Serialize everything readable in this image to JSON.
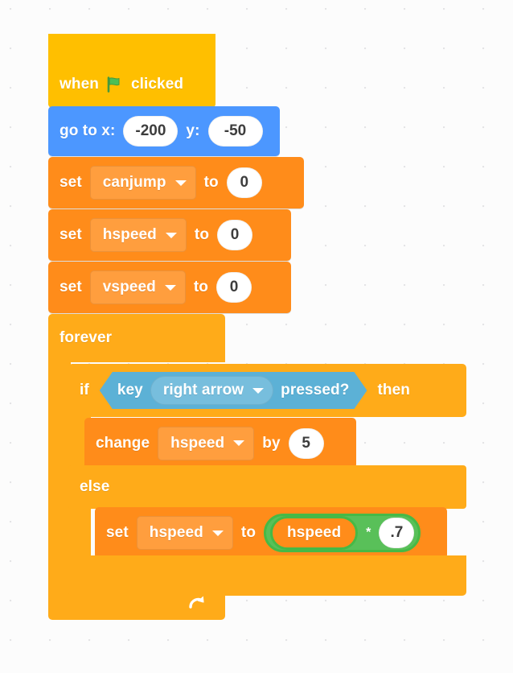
{
  "workspace": {
    "background_color": "#fcfcfc",
    "dot_grid": true
  },
  "palette": {
    "events_yellow": "#FFBF00",
    "motion_blue": "#4C97FF",
    "variables_orange": "#FF8C1A",
    "control_amber": "#FFAB19",
    "sensing_blue": "#5CB1D6",
    "operators_green": "#59C059",
    "operators_green_outline": "#46B946",
    "input_white": "#FFFFFF",
    "text_white": "#FFFFFF",
    "input_text_dark": "#3D3D3D"
  },
  "script": {
    "hat": {
      "word_when": "when",
      "flag_icon": "green-flag-icon",
      "word_clicked": "clicked"
    },
    "goto": {
      "label_x": "go to x:",
      "value_x": "-200",
      "label_y": "y:",
      "value_y": "-50"
    },
    "set_blocks": [
      {
        "verb": "set",
        "variable": "canjump",
        "to": "to",
        "value": "0",
        "dropdown_icon": "chevron-down-icon"
      },
      {
        "verb": "set",
        "variable": "hspeed",
        "to": "to",
        "value": "0",
        "dropdown_icon": "chevron-down-icon"
      },
      {
        "verb": "set",
        "variable": "vspeed",
        "to": "to",
        "value": "0",
        "dropdown_icon": "chevron-down-icon"
      }
    ],
    "forever": {
      "label": "forever",
      "loop_icon": "loop-arrow-icon"
    },
    "if_else": {
      "if_label": "if",
      "then_label": "then",
      "else_label": "else",
      "condition": {
        "prefix": "key",
        "key_name": "right arrow",
        "suffix": "pressed?",
        "dropdown_icon": "chevron-down-icon"
      },
      "then_branch": {
        "verb": "change",
        "variable": "hspeed",
        "by": "by",
        "value": "5",
        "dropdown_icon": "chevron-down-icon"
      },
      "else_branch": {
        "verb": "set",
        "variable": "hspeed",
        "to": "to",
        "dropdown_icon": "chevron-down-icon",
        "operator": {
          "left_reporter": "hspeed",
          "symbol": "*",
          "right_value": ".7"
        }
      }
    }
  }
}
